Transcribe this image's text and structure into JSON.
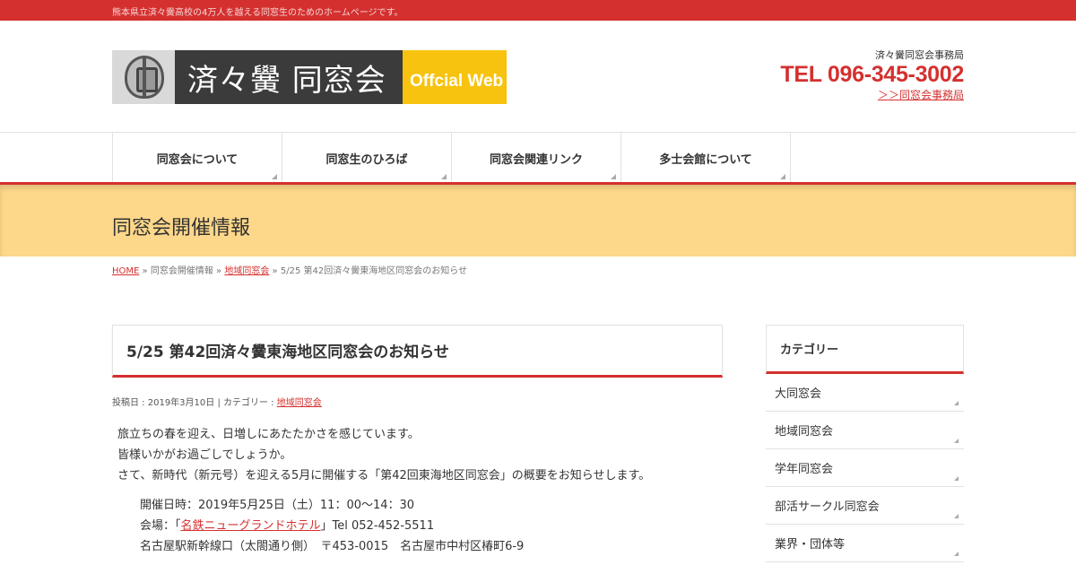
{
  "topbar": {
    "description": "熊本県立済々黌高校の4万人を越える同窓生のためのホームページです。"
  },
  "logo": {
    "name": "済々黌 同窓会",
    "tagline": "Offcial Web",
    "crest_icon": "school-crest-icon"
  },
  "contact": {
    "office": "済々黌同窓会事務局",
    "tel": "TEL 096-345-3002",
    "link": "＞＞同窓会事務局"
  },
  "nav": {
    "items": [
      {
        "label": "同窓会について"
      },
      {
        "label": "同窓生のひろば"
      },
      {
        "label": "同窓会関連リンク"
      },
      {
        "label": "多士会館について"
      }
    ]
  },
  "page": {
    "title": "同窓会開催情報"
  },
  "breadcrumb": {
    "home": "HOME",
    "sep": "»",
    "section": "同窓会開催情報",
    "category": "地域同窓会",
    "current": "5/25 第42回済々黌東海地区同窓会のお知らせ"
  },
  "post": {
    "title": "5/25 第42回済々黌東海地区同窓会のお知らせ",
    "meta_prefix": "投稿日 : 2019年3月10日 | カテゴリー : ",
    "meta_category": "地域同窓会",
    "paragraphs": [
      "旅立ちの春を迎え、日増しにあたたかさを感じています。",
      "皆様いかがお過ごしでしょうか。",
      "さて、新時代（新元号）を迎える5月に開催する「第42回東海地区同窓会」の概要をお知らせします。"
    ],
    "detail": {
      "datetime": "開催日時：2019年5月25日（土）11：00～14：30",
      "venue_prefix": "会場：「",
      "venue_link": "名鉄ニューグランドホテル",
      "venue_suffix": "」Tel 052-452-5511",
      "address": "名古屋駅新幹線口（太閤通り側）　〒453-0015　名古屋市中村区椿町6-9"
    }
  },
  "sidebar": {
    "title": "カテゴリー",
    "items": [
      {
        "label": "大同窓会"
      },
      {
        "label": "地域同窓会"
      },
      {
        "label": "学年同窓会"
      },
      {
        "label": "部活サークル同窓会"
      },
      {
        "label": "業界・団体等"
      }
    ]
  },
  "colors": {
    "accent": "#d4302f",
    "header_band": "#fdd78a",
    "logo_yellow": "#f7c30e",
    "logo_dark": "#3b3b3b"
  }
}
